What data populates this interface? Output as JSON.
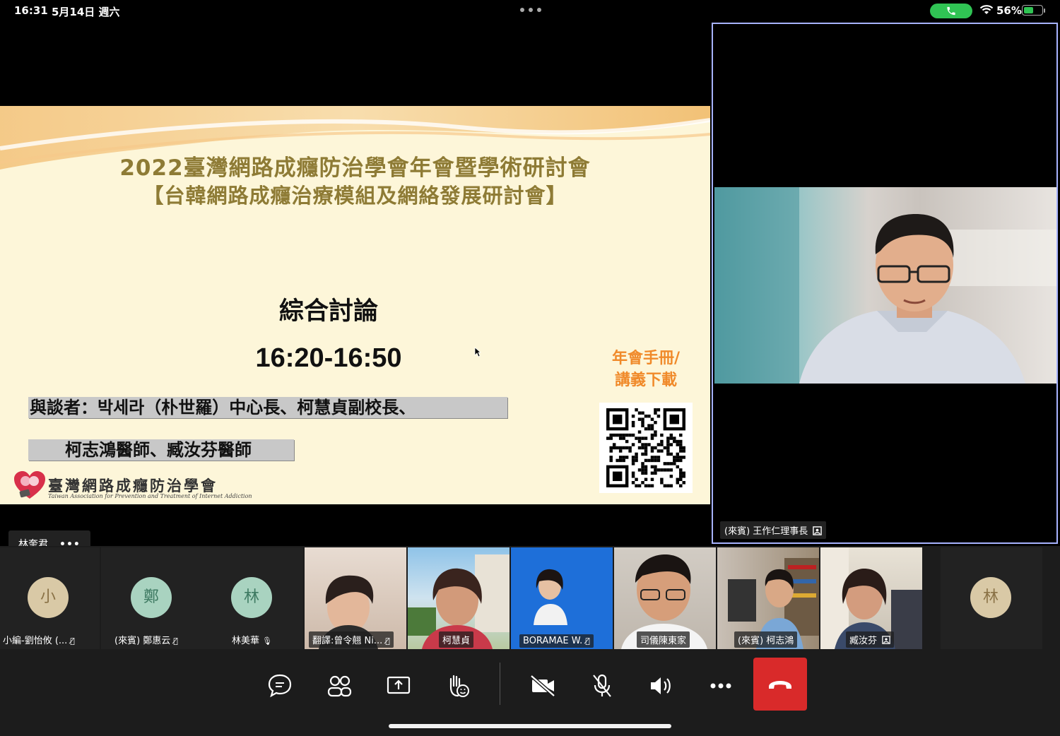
{
  "status_bar": {
    "time": "16:31",
    "date": "5月14日 週六",
    "battery_pct": "56%",
    "battery_level": 0.56,
    "call_color": "#30c454"
  },
  "slide": {
    "title_line1": "2022臺灣網路成癮防治學會年會暨學術研討會",
    "title_line2": "【台韓網路成癮治療模組及網絡發展研討會】",
    "heading": "綜合討論",
    "time_range": "16:20-16:50",
    "panel_line1": "與談者：박세라（朴世羅）中心長、柯慧貞副校長、",
    "panel_line2": "柯志鴻醫師、臧汝芬醫師",
    "download_label_line1": "年會手冊/",
    "download_label_line2": "講義下載",
    "org_name": "臺灣網路成癮防治學會",
    "org_subtitle": "Taiwan Association for Prevention and Treatment of Internet Addiction",
    "title_color": "#8e7b35",
    "accent_color": "#f08a2a"
  },
  "presenter": {
    "name": "林奎君",
    "more": "•••"
  },
  "active_speaker": {
    "name": "(來賓) 王作仁理事長",
    "border_color": "#a7b3ff"
  },
  "gallery": [
    {
      "label": "小編-劉怡攸 (...",
      "initial": "小",
      "type": "avatar",
      "avatar_color": "#d9c9a6",
      "text_color": "#8a7246",
      "mic": "muted"
    },
    {
      "label": "(來賓) 鄭惠云",
      "initial": "鄭",
      "type": "avatar",
      "avatar_color": "#a9d3c0",
      "text_color": "#3e7a62",
      "mic": "muted"
    },
    {
      "label": "林美華",
      "initial": "林",
      "type": "avatar",
      "avatar_color": "#a9d3c0",
      "text_color": "#3e7a62",
      "mic": "on"
    },
    {
      "label": "翻譯:曾令翹 Ni...",
      "type": "video",
      "mic": "muted"
    },
    {
      "label": "柯慧貞",
      "type": "video",
      "mic": "none"
    },
    {
      "label": "BORAMAE W.",
      "type": "video",
      "mic": "muted"
    },
    {
      "label": "司儀陳東家",
      "type": "video",
      "mic": "none"
    },
    {
      "label": "(來賓) 柯志鴻",
      "type": "video",
      "mic": "none"
    },
    {
      "label": "臧汝芬",
      "type": "video",
      "mic": "screen"
    },
    {
      "label": "",
      "initial": "林",
      "type": "avatar",
      "avatar_color": "#d9c9a6",
      "text_color": "#8a7246",
      "mic": "none"
    }
  ],
  "controls": [
    {
      "name": "chat-button",
      "icon": "chat-icon"
    },
    {
      "name": "participants-button",
      "icon": "people-icon"
    },
    {
      "name": "share-button",
      "icon": "share-icon"
    },
    {
      "name": "raise-hand-button",
      "icon": "hand-icon"
    },
    {
      "name": "camera-button",
      "icon": "camera-off-icon"
    },
    {
      "name": "mic-button",
      "icon": "mic-off-icon"
    },
    {
      "name": "speaker-button",
      "icon": "speaker-icon"
    },
    {
      "name": "more-button",
      "icon": "more-icon"
    },
    {
      "name": "leave-button",
      "icon": "hangup-icon",
      "color": "#d92a2a"
    }
  ]
}
